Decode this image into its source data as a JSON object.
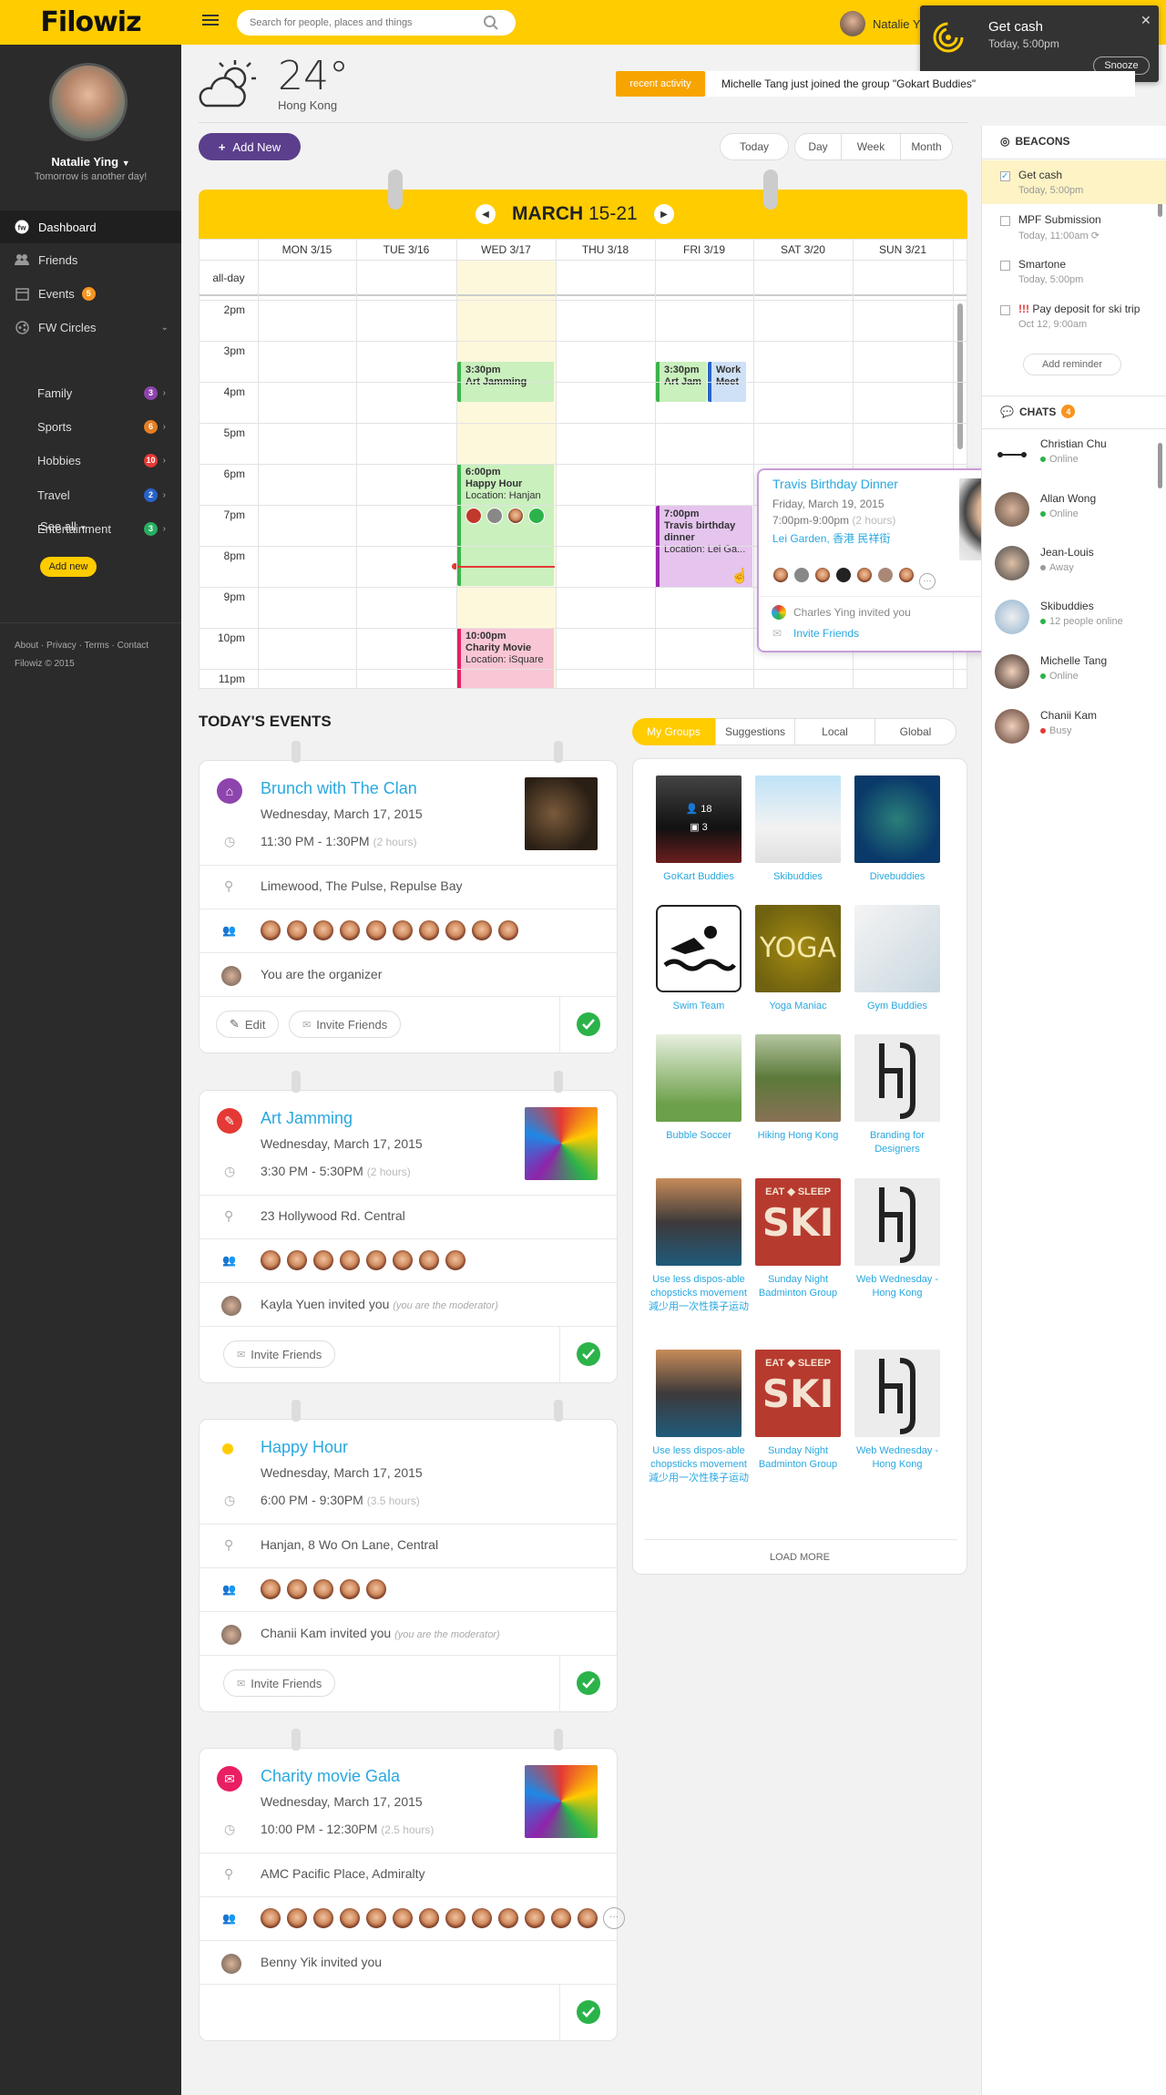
{
  "header": {
    "logo": "Filowiz",
    "search_placeholder": "Search for people, places and things",
    "user_name": "Natalie Y"
  },
  "notification": {
    "title": "Get cash",
    "time": "Today, 5:00pm",
    "snooze_label": "Snooze"
  },
  "sidebar": {
    "user_name": "Natalie Ying",
    "status": "Tomorrow is another day!",
    "nav": {
      "dashboard": "Dashboard",
      "friends": "Friends",
      "events": "Events",
      "events_badge": "5",
      "circles": "FW Circles"
    },
    "circles": [
      {
        "label": "Family",
        "count": "3",
        "color": "#8e44ad"
      },
      {
        "label": "Sports",
        "count": "6",
        "color": "#e67e22"
      },
      {
        "label": "Hobbies",
        "count": "10",
        "color": "#e53935"
      },
      {
        "label": "Travel",
        "count": "2",
        "color": "#2962c9"
      },
      {
        "label": "Entertainment",
        "count": "3",
        "color": "#27ae60"
      }
    ],
    "see_all": "See all",
    "add_new": "Add new",
    "footer_links": "About · Privacy · Terms · Contact",
    "copyright": "Filowiz © 2015"
  },
  "weather": {
    "temp": "24°",
    "city": "Hong Kong"
  },
  "recent_activity": {
    "label": "recent activity",
    "text": "Michelle Tang  just joined the group \"Gokart Buddies\""
  },
  "calendar": {
    "add_new": "Add New",
    "today": "Today",
    "views": [
      "Day",
      "Week",
      "Month"
    ],
    "month": "MARCH",
    "range": "15-21",
    "days": [
      "MON 3/15",
      "TUE 3/16",
      "WED 3/17",
      "THU 3/18",
      "FRI 3/19",
      "SAT 3/20",
      "SUN 3/21"
    ],
    "allday": "all-day",
    "hours": [
      "2pm",
      "3pm",
      "4pm",
      "5pm",
      "6pm",
      "7pm",
      "8pm",
      "9pm",
      "10pm",
      "11pm"
    ],
    "events": {
      "art_time": "3:30pm",
      "art_title": "Art Jamming",
      "hh_time": "6:00pm",
      "hh_title": "Happy Hour",
      "hh_loc": "Location: Hanjan",
      "cm_time": "10:00pm",
      "cm_title": "Charity Movie",
      "cm_loc": "Location: iSquare",
      "fri1_time": "3:30pm",
      "fri1_title": "Art Jam",
      "fri2_title": "Work Meet",
      "tb_time": "7:00pm",
      "tb_title": "Travis birthday dinner",
      "tb_loc": "Location: Lei Ga..."
    }
  },
  "popover": {
    "title": "Travis Birthday Dinner",
    "date": "Friday, March 19, 2015",
    "time": "7:00pm-9:00pm",
    "duration": "(2 hours)",
    "location": "Lei Garden, 香港 民祥街",
    "invited": "Charles Ying invited you",
    "invite_link": "Invite Friends"
  },
  "todays_events": {
    "heading": "TODAY'S EVENTS",
    "items": [
      {
        "title": "Brunch with The Clan",
        "date": "Wednesday, March 17, 2015",
        "time": "11:30 PM - 1:30PM",
        "dur": "(2 hours)",
        "place": "Limewood, The Pulse, Repulse Bay",
        "note": "You are the organizer",
        "note2": "",
        "edit": "Edit",
        "invite": "Invite Friends"
      },
      {
        "title": "Art Jamming",
        "date": "Wednesday, March 17, 2015",
        "time": "3:30 PM - 5:30PM",
        "dur": "(2 hours)",
        "place": "23 Hollywood Rd. Central",
        "note": "Kayla Yuen invited you",
        "note2": "(you are the moderator)",
        "invite": "Invite Friends"
      },
      {
        "title": "Happy Hour",
        "date": "Wednesday, March 17, 2015",
        "time": "6:00 PM - 9:30PM",
        "dur": "(3.5 hours)",
        "place": "Hanjan, 8 Wo On Lane, Central",
        "note": "Chanii Kam invited you",
        "note2": "(you are the moderator)",
        "invite": "Invite Friends"
      },
      {
        "title": "Charity movie Gala",
        "date": "Wednesday, March 17, 2015",
        "time": "10:00 PM - 12:30PM",
        "dur": "(2.5 hours)",
        "place": "AMC Pacific Place, Admiralty",
        "note": "Benny Yik invited you",
        "note2": ""
      }
    ]
  },
  "groups": {
    "tabs": [
      "My Groups",
      "Suggestions",
      "Local",
      "Global"
    ],
    "gokart_members": "18",
    "gokart_events": "3",
    "yoga_text": "YOGA",
    "ski_top": "EAT ◆ SLEEP",
    "ski_big": "SKI",
    "items": [
      "GoKart Buddies",
      "Skibuddies",
      "Divebuddies",
      "Swim Team",
      "Yoga Maniac",
      "Gym Buddies",
      "Bubble Soccer",
      "Hiking Hong Kong",
      "Branding for Designers",
      "Use less dispos-able chopsticks movement 減少用一次性筷子运动",
      "Sunday Night Badminton Group",
      "Web Wednesday - Hong Kong",
      "Use less dispos-able chopsticks movement 減少用一次性筷子运动",
      "Sunday Night Badminton Group",
      "Web Wednesday - Hong Kong"
    ],
    "load_more": "LOAD MORE"
  },
  "beacons": {
    "heading": "BEACONS",
    "items": [
      {
        "title": "Get cash",
        "time": "Today, 5:00pm",
        "prefix": ""
      },
      {
        "title": "MPF Submission",
        "time": "Today, 11:00am",
        "prefix": ""
      },
      {
        "title": "Smartone",
        "time": "Today, 5:00pm",
        "prefix": ""
      },
      {
        "title": "Pay deposit for ski trip",
        "time": "Oct 12, 9:00am",
        "prefix": "!!!"
      }
    ],
    "add_reminder": "Add reminder"
  },
  "chats": {
    "heading": "CHATS",
    "count": "4",
    "items": [
      {
        "name": "Christian Chu",
        "status": "Online",
        "color": "#2bb34a"
      },
      {
        "name": "Allan Wong",
        "status": "Online",
        "color": "#2bb34a"
      },
      {
        "name": "Jean-Louis",
        "status": "Away",
        "color": "#999999"
      },
      {
        "name": "Skibuddies",
        "status": "12 people online",
        "color": "#2bb34a"
      },
      {
        "name": "Michelle Tang",
        "status": "Online",
        "color": "#2bb34a"
      },
      {
        "name": "Chanii Kam",
        "status": "Busy",
        "color": "#e53935"
      }
    ]
  },
  "colors": {
    "brand": "#ffcc00",
    "accent_blue": "#29a8e0",
    "purple": "#5b3f8c"
  }
}
